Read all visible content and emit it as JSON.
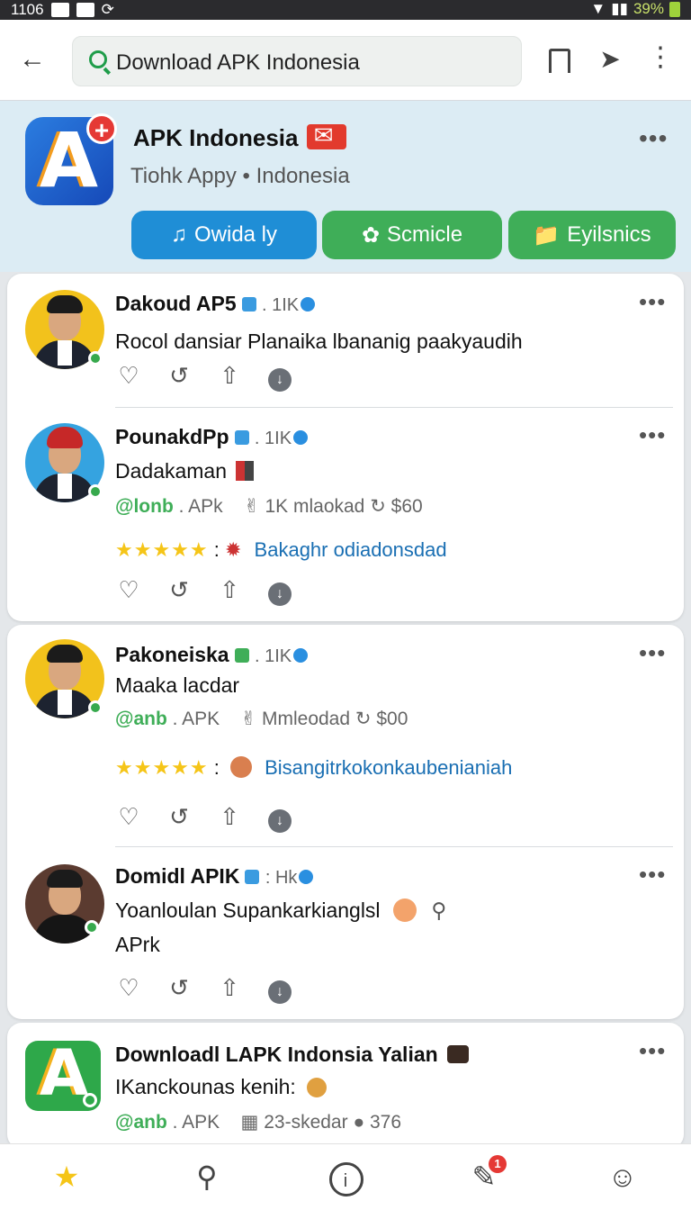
{
  "status": {
    "time": "1106",
    "battery": "39%"
  },
  "search": {
    "query": "Download APK Indonesia"
  },
  "hero": {
    "title": "APK Indonesia",
    "subtitle": "Tiohk Appy • Indonesia",
    "buttons": [
      "Owida ly",
      "Scmicle",
      "Eyilsnics"
    ]
  },
  "posts": [
    {
      "name": "Dakoud AP5",
      "meta": ". 1IK",
      "text": "Rocol dansiar Planaika lbananig paakyaudih"
    },
    {
      "name": "PounakdPp",
      "meta": ". 1IK",
      "text": "Dadakaman",
      "handle": "@lonb",
      "handle_suffix": ". APk",
      "stat1": "1K mlaokad",
      "stat2": "$60",
      "rating_tag": "Bakaghr odiadonsdad"
    },
    {
      "name": "Pakoneiska",
      "meta": ". 1IK",
      "text": "Maaka lacdar",
      "handle": "@anb",
      "handle_suffix": ". APK",
      "stat1": "Mmleodad",
      "stat2": "$00",
      "rating_tag": "Bisangitrkokonkaubenianiah"
    },
    {
      "name": "Domidl APIK",
      "meta": ": Hk",
      "text": "Yoanloulan Supankarkianglsl",
      "text2": "APrk"
    },
    {
      "name": "Downloadl LAPK Indonsia Yalian",
      "text": "IKanckounas kenih:",
      "handle": "@anb",
      "handle_suffix": ". APK",
      "stat1": "23-skedar",
      "stat2": "376"
    }
  ],
  "nav": {
    "badge": "1"
  },
  "colors": {
    "accent_blue": "#1f8ed6",
    "accent_green": "#3fae58",
    "star": "#f5c518"
  }
}
